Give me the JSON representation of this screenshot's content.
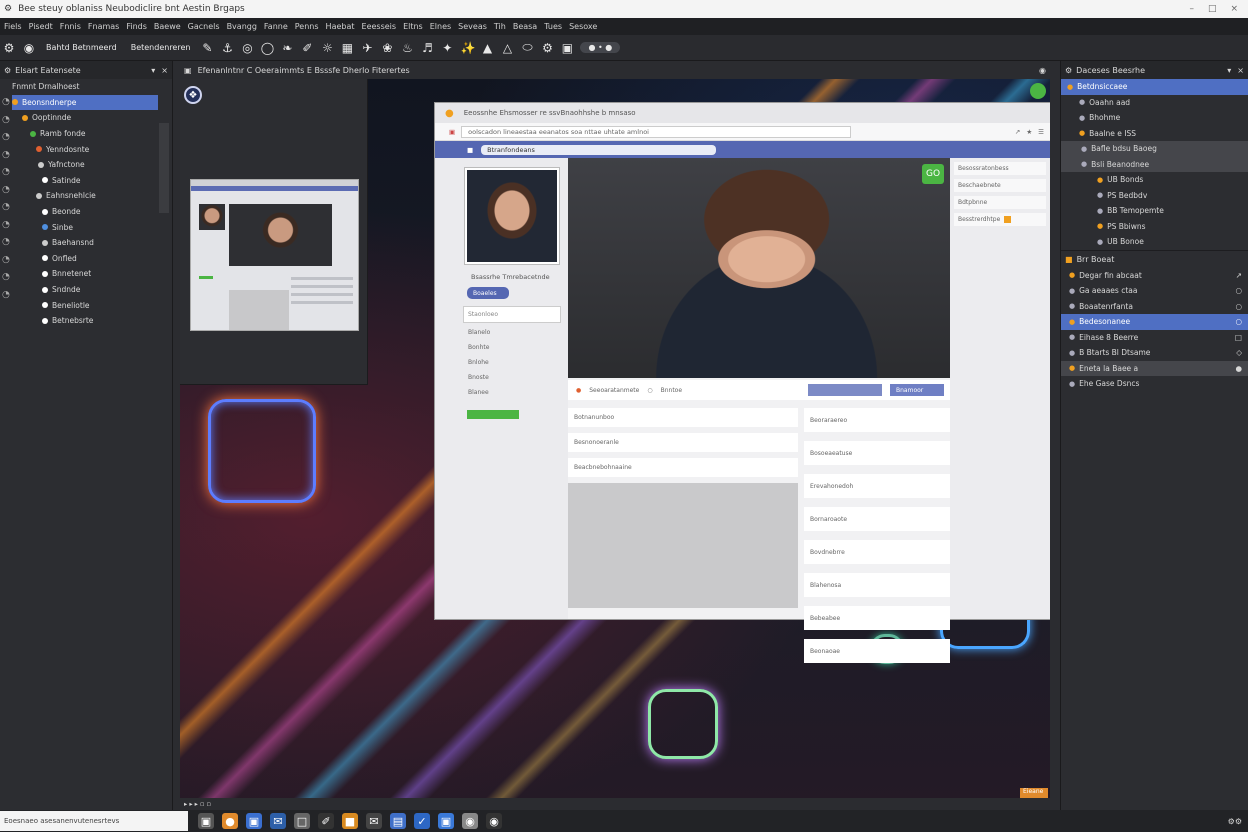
{
  "window": {
    "title": "Bee steuy oblaniss  Neubodiclire bnt Aestin Brgaps",
    "controls": [
      "–",
      "□",
      "×"
    ]
  },
  "menu": [
    "Fiels",
    "Pisedt",
    "Fnnis",
    "Fnamas",
    "Finds",
    "Baewe",
    "Gacnels",
    "Bvangg",
    "Fanne",
    "Penns",
    "Haebat",
    "Eeesseis",
    "Eltns",
    "Elnes",
    "Seveas",
    "Tih",
    "Beasa",
    "Tues",
    "Sesoxe"
  ],
  "toolbar": {
    "label1": "Bahtd Betnmeerd",
    "label2": "Betendenreren",
    "zoom": "● • ●"
  },
  "left_panel": {
    "title": "Elsart  Eatensete",
    "items": [
      {
        "label": "Fnmnt Drnalhoest",
        "sel": false
      },
      {
        "label": "Beonsndnerpe",
        "sel": true
      },
      {
        "label": "Ooptinnde",
        "sel": false
      },
      {
        "label": "Ramb fonde",
        "sel": false
      },
      {
        "label": "Yenndosnte",
        "sel": false
      },
      {
        "label": "Yafnctone",
        "sel": false
      },
      {
        "label": "Satinde",
        "sel": false
      },
      {
        "label": "Eahnsnehlcie",
        "sel": false
      },
      {
        "label": "Beonde",
        "sel": false
      },
      {
        "label": "Sinbe",
        "sel": false
      },
      {
        "label": "Baehansnd",
        "sel": false
      },
      {
        "label": "Onfled",
        "sel": false
      },
      {
        "label": "Bnnetenet",
        "sel": false
      },
      {
        "label": "Sndnde",
        "sel": false
      },
      {
        "label": "Beneliotle",
        "sel": false
      },
      {
        "label": "Betnebsrte",
        "sel": false
      }
    ]
  },
  "viewport": {
    "tabs": "Efenanlntnr C Oeeraimmts E Bsssfe Dherlo Fiterertes",
    "bottom": "▸ ▸ ▸  ▫  ▫"
  },
  "web": {
    "tab": "Eeossnhe        Ehsmosser re ssvBnaohhshe b mnsaso",
    "url": "oolscadon lineaestaa eeanatos soa nttae uhtate amlnoi",
    "search": "Btranfondeans",
    "profile_name": "Bsassrhe Tmrebacetnde",
    "follow": "Boaeles",
    "input_placeholder": "Staonloeo",
    "links": [
      "Blanelo",
      "Bonhte",
      "Bnlohe",
      "Bnoste",
      "Blanee"
    ],
    "badge": "GO",
    "actions": [
      "Seeoaratanmete",
      "Bnntoe"
    ],
    "action_btn": "Bnamoor",
    "right_items": [
      "Besossratonbess",
      "Beschaebnete",
      "Bdtpbnne",
      "Besstrerdhtpe"
    ],
    "feed_left": [
      "Botnanunboo",
      "Besnonoeranle",
      "Beacbnebohnaaine"
    ],
    "feed_right": [
      "Beoraraereo",
      "Bosoeaeatuse",
      "Erevahonedoh",
      "Bornaroaote",
      "Bovdnebrre",
      "Blahenosa",
      "Bebeabee",
      "Beonaoae"
    ],
    "corner": "Eieane"
  },
  "right_panel": {
    "title": "Daceses Beesrhe",
    "items": [
      {
        "label": "Betdnsiccaee",
        "style": "sel"
      },
      {
        "label": "Oaahn aad",
        "style": ""
      },
      {
        "label": "Bhohme",
        "style": ""
      },
      {
        "label": "Baalne e ISS",
        "style": ""
      },
      {
        "label": "Bafle bdsu Baoeg",
        "style": "hl"
      },
      {
        "label": "Bsli Beanodnee",
        "style": "hl"
      },
      {
        "label": "UB Bonds",
        "style": ""
      },
      {
        "label": "PS Bedbdv",
        "style": ""
      },
      {
        "label": "BB Temopemte",
        "style": ""
      },
      {
        "label": "PS Bbiwns",
        "style": ""
      },
      {
        "label": "UB Bonoe",
        "style": ""
      }
    ],
    "section1": "Brr Boeat",
    "section2_items": [
      {
        "label": "Degar fin abcaat",
        "style": "",
        "r": "↗"
      },
      {
        "label": "Ga aeaaes ctaa",
        "style": "",
        "r": "○"
      },
      {
        "label": "Boaatenrfanta",
        "style": "",
        "r": "○"
      },
      {
        "label": "Bedesonanee",
        "style": "sel",
        "r": "○"
      },
      {
        "label": "Eihase 8 Beerre",
        "style": "",
        "r": "□"
      },
      {
        "label": "B Btarts Bl Dtsame",
        "style": "",
        "r": "◇"
      },
      {
        "label": "Eneta la Baee a",
        "style": "hl",
        "r": "●"
      },
      {
        "label": "Ehe Gase Dsncs",
        "style": "",
        "r": ""
      }
    ]
  },
  "status": {
    "field": "Eoesnaeo asesanenvutenesrtevs",
    "right": "⚙⚙"
  },
  "colors": {
    "accent": "#4f6fc3",
    "green": "#4bb543",
    "orange": "#e08a2c"
  }
}
